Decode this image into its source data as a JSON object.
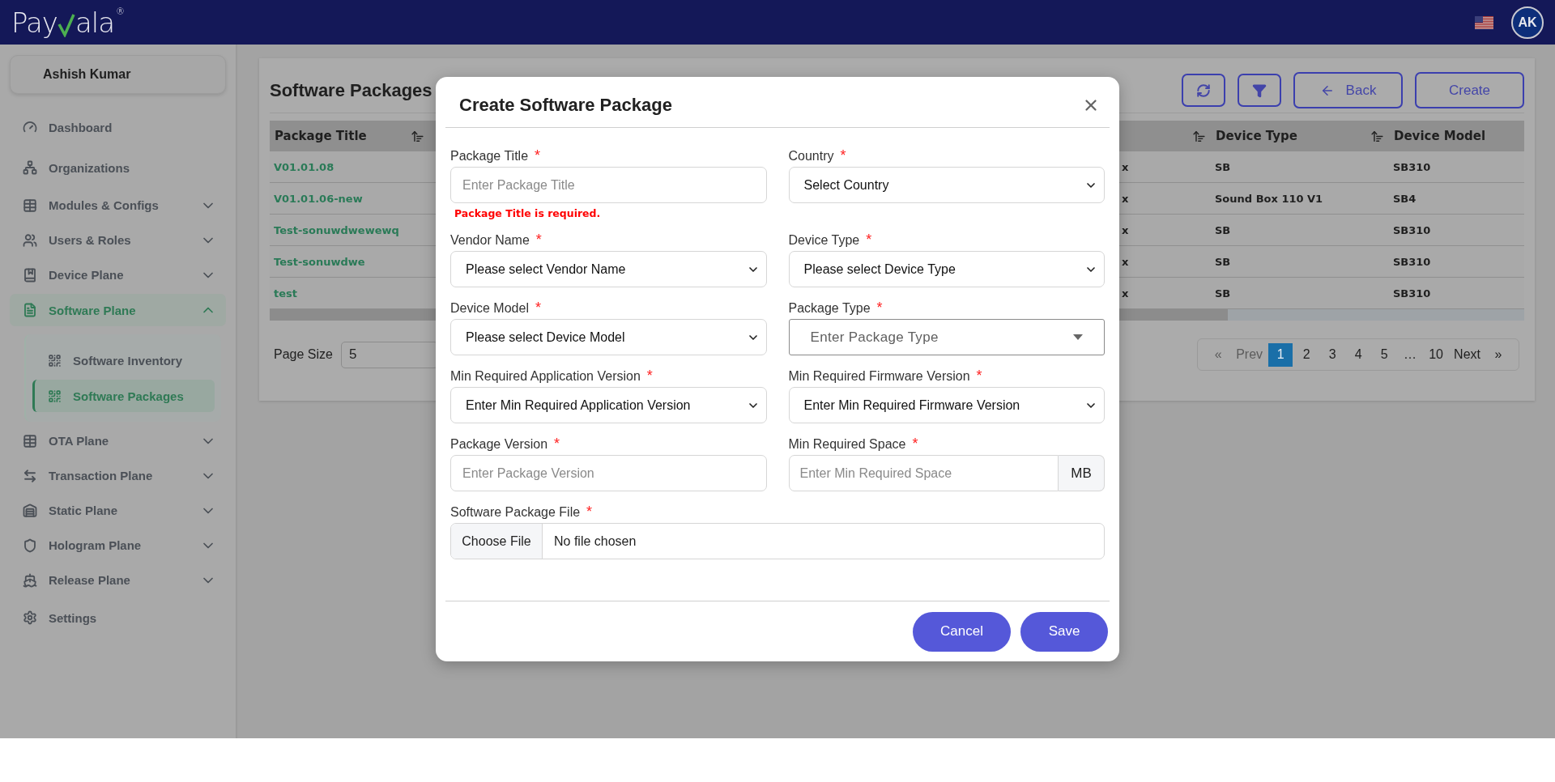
{
  "header": {
    "logo": {
      "before": "Pay",
      "after": "ala",
      "mark": "®"
    },
    "avatar": "AK"
  },
  "sidebar": {
    "user": "Ashish Kumar",
    "items": [
      {
        "label": "Dashboard",
        "expandable": false,
        "selected": false
      },
      {
        "label": "Organizations",
        "expandable": false,
        "selected": false
      },
      {
        "label": "Modules & Configs",
        "expandable": true,
        "expanded": false,
        "selected": false
      },
      {
        "label": "Users & Roles",
        "expandable": true,
        "expanded": false,
        "selected": false
      },
      {
        "label": "Device Plane",
        "expandable": true,
        "expanded": false,
        "selected": false
      },
      {
        "label": "Software Plane",
        "expandable": true,
        "expanded": true,
        "selected": true,
        "children": [
          {
            "label": "Software Inventory",
            "selected": false
          },
          {
            "label": "Software Packages",
            "selected": true
          }
        ]
      },
      {
        "label": "OTA Plane",
        "expandable": true,
        "expanded": false,
        "selected": false
      },
      {
        "label": "Transaction Plane",
        "expandable": true,
        "expanded": false,
        "selected": false
      },
      {
        "label": "Static Plane",
        "expandable": true,
        "expanded": false,
        "selected": false
      },
      {
        "label": "Hologram Plane",
        "expandable": true,
        "expanded": false,
        "selected": false
      },
      {
        "label": "Release Plane",
        "expandable": true,
        "expanded": false,
        "selected": false
      },
      {
        "label": "Settings",
        "expandable": false,
        "selected": false
      }
    ]
  },
  "page": {
    "title": "Software Packages",
    "buttons": {
      "back": "Back",
      "create": "Create"
    },
    "table": {
      "columns": [
        "Package Title",
        "Device Type",
        "Device Model"
      ],
      "rows": [
        {
          "package_title": "V01.01.08",
          "column_3": "x",
          "device_type": "SB",
          "device_model": "SB310"
        },
        {
          "package_title": "V01.01.06-new",
          "column_3": "x",
          "device_type": "Sound Box 110 V1",
          "device_model": "SB4"
        },
        {
          "package_title": "Test-sonuwdwewewq",
          "column_3": "x",
          "device_type": "SB",
          "device_model": "SB310"
        },
        {
          "package_title": "Test-sonuwdwe",
          "column_3": "x",
          "device_type": "SB",
          "device_model": "SB310"
        },
        {
          "package_title": "test",
          "column_3": "x",
          "device_type": "SB",
          "device_model": "SB310"
        }
      ]
    },
    "page_size": {
      "label": "Page Size",
      "value": "5"
    },
    "pagination": {
      "first": "«",
      "prev": {
        "label": "Prev",
        "disabled": true
      },
      "pages": [
        {
          "label": "1",
          "selected": true
        },
        {
          "label": "2",
          "selected": false
        },
        {
          "label": "3",
          "selected": false
        },
        {
          "label": "4",
          "selected": false
        },
        {
          "label": "5",
          "selected": false
        },
        {
          "label": "…",
          "selected": false
        },
        {
          "label": "10",
          "selected": false
        }
      ],
      "next": {
        "label": "Next",
        "disabled": false
      },
      "last": "»"
    }
  },
  "modal": {
    "title": "Create Software Package",
    "fields": [
      {
        "kind": "input",
        "label": "Package Title",
        "required_mark": "*",
        "placeholder": "Enter Package Title",
        "error": "Package Title is required."
      },
      {
        "kind": "select",
        "label": "Country",
        "required_mark": "*",
        "value": "Select Country"
      },
      {
        "kind": "select",
        "label": "Vendor Name",
        "required_mark": "*",
        "value": "Please select Vendor Name"
      },
      {
        "kind": "select",
        "label": "Device Type",
        "required_mark": "*",
        "value": "Please select Device Type"
      },
      {
        "kind": "select",
        "label": "Device Model",
        "required_mark": "*",
        "value": "Please select Device Model"
      },
      {
        "kind": "combo",
        "label": "Package Type",
        "required_mark": "*",
        "placeholder": "Enter Package Type"
      },
      {
        "kind": "select",
        "label": "Min Required Application Version",
        "required_mark": "*",
        "value": "Enter Min Required Application Version"
      },
      {
        "kind": "select",
        "label": "Min Required Firmware Version",
        "required_mark": "*",
        "value": "Enter Min Required Firmware Version"
      },
      {
        "kind": "input",
        "label": "Package Version",
        "required_mark": "*",
        "placeholder": "Enter Package Version"
      },
      {
        "kind": "addon",
        "label": "Min Required Space",
        "required_mark": "*",
        "placeholder": "Enter Min Required Space",
        "addon": "MB"
      },
      {
        "kind": "file",
        "label": "Software Package File",
        "required_mark": "*",
        "button": "Choose File",
        "status": "No file chosen"
      }
    ],
    "buttons": {
      "cancel": "Cancel",
      "save": "Save"
    }
  }
}
